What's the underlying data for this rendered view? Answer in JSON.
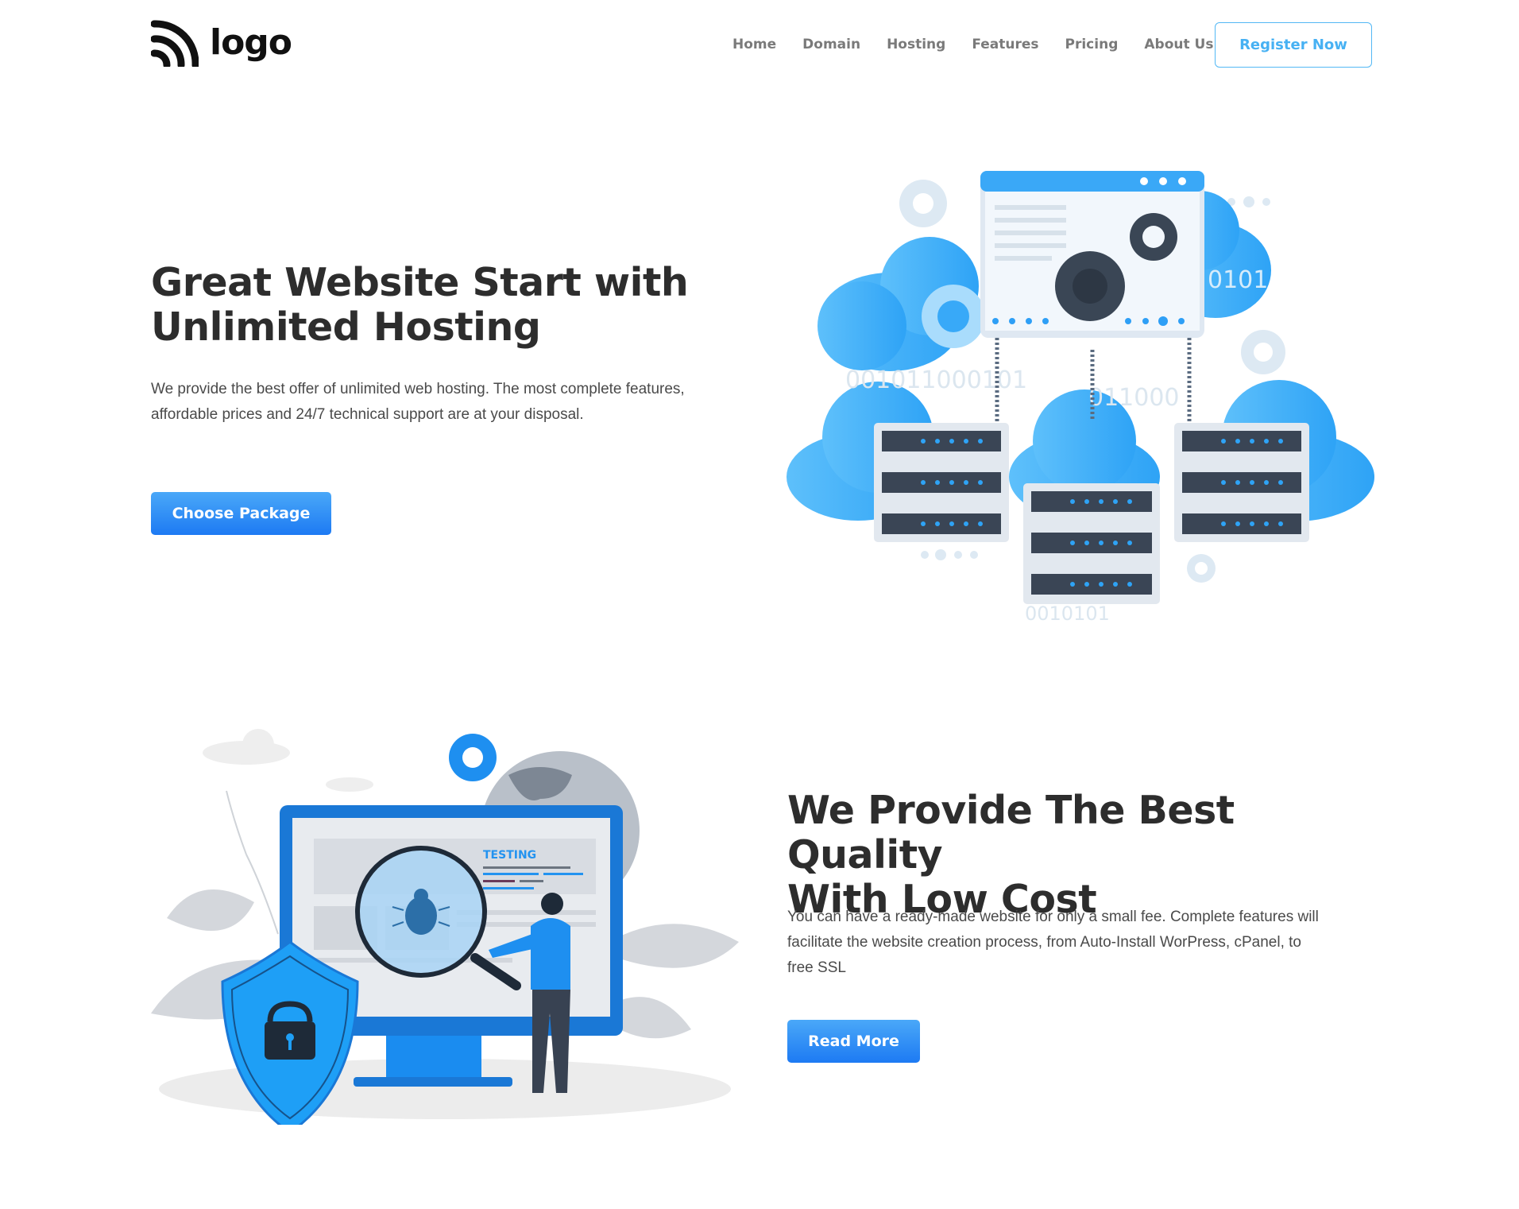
{
  "header": {
    "logo_text": "logo",
    "nav": [
      "Home",
      "Domain",
      "Hosting",
      "Features",
      "Pricing",
      "About Us"
    ],
    "register_label": "Register Now"
  },
  "hero": {
    "title_line1": "Great Website Start with",
    "title_line2": "Unlimited Hosting",
    "description": "We provide the best offer of unlimited web hosting. The most complete features, affordable prices and 24/7 technical support are at your disposal.",
    "button_label": "Choose Package",
    "illustration_texts": [
      "0101",
      "001011000101",
      "011000",
      "0010101"
    ]
  },
  "section2": {
    "title_line1": "We Provide The Best Quality",
    "title_line2": "With Low Cost",
    "description": "You can have a ready-made website for only a small fee. Complete features will facilitate the website creation process, from Auto-Install WorPress, cPanel, to free SSL",
    "button_label": "Read More",
    "illustration_label": "TESTING"
  },
  "colors": {
    "accent_blue": "#1d7af3",
    "light_blue": "#47b1f3",
    "cloud_blue": "#5bbcf7",
    "dark_text": "#2d2d2d",
    "body_text": "#4a4a4a",
    "nav_text": "#7a7a7a"
  },
  "icons": [
    "rss-logo-icon",
    "gear-icon",
    "server-icon",
    "cloud-icon",
    "bug-icon",
    "magnifier-icon",
    "lock-icon",
    "shield-icon",
    "globe-icon",
    "leaf-icon"
  ]
}
